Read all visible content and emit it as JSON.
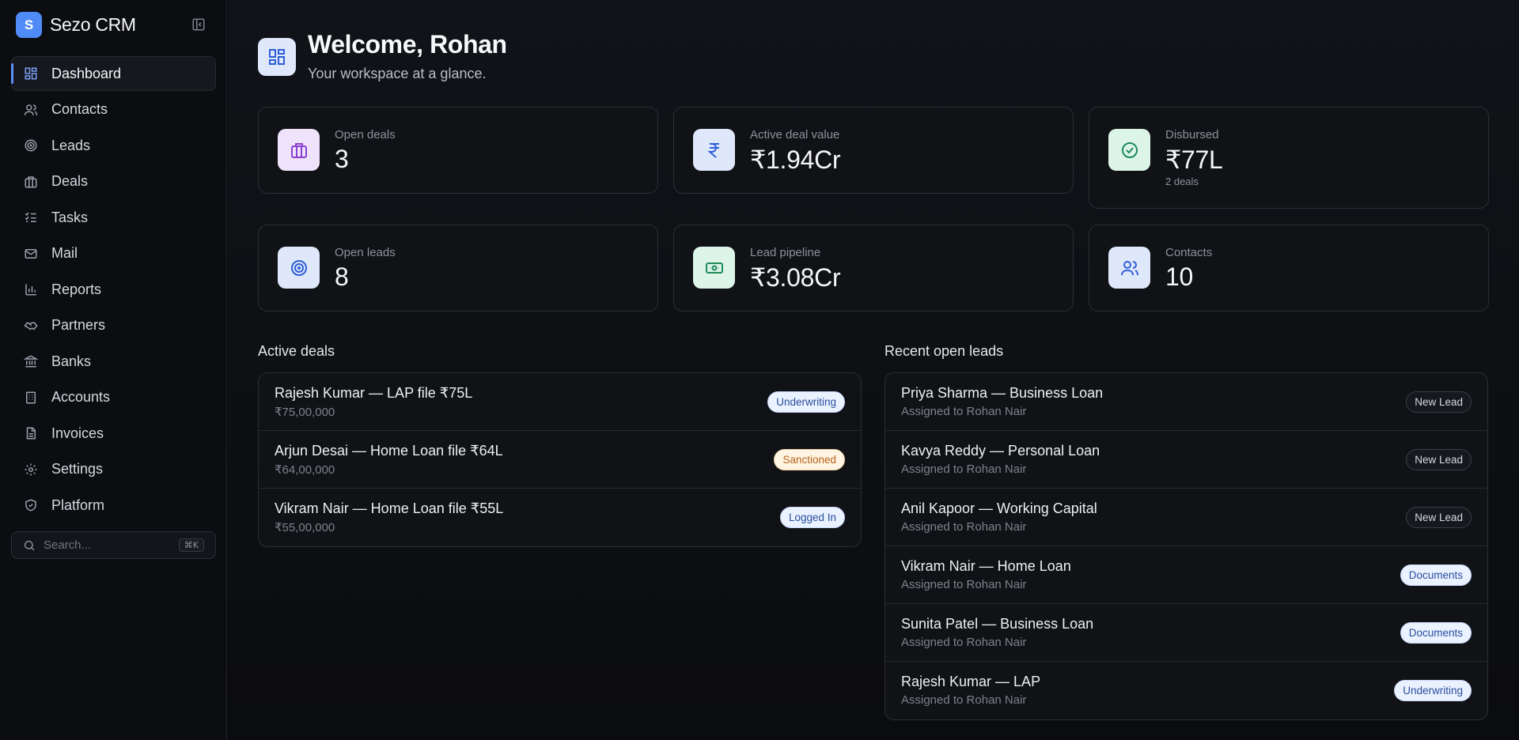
{
  "sidebar": {
    "brand_letter": "S",
    "brand_name": "Sezo CRM",
    "items": [
      {
        "label": "Dashboard",
        "icon": "dashboard-icon",
        "active": true
      },
      {
        "label": "Contacts",
        "icon": "users-icon"
      },
      {
        "label": "Leads",
        "icon": "target-icon"
      },
      {
        "label": "Deals",
        "icon": "briefcase-icon"
      },
      {
        "label": "Tasks",
        "icon": "checklist-icon"
      },
      {
        "label": "Mail",
        "icon": "mail-icon"
      },
      {
        "label": "Reports",
        "icon": "bar-chart-icon"
      },
      {
        "label": "Partners",
        "icon": "handshake-icon"
      },
      {
        "label": "Banks",
        "icon": "bank-icon"
      },
      {
        "label": "Accounts",
        "icon": "building-icon"
      },
      {
        "label": "Invoices",
        "icon": "file-icon"
      },
      {
        "label": "Settings",
        "icon": "gear-icon"
      },
      {
        "label": "Platform",
        "icon": "shield-icon"
      }
    ],
    "search_placeholder": "Search...",
    "search_shortcut": "⌘K"
  },
  "header": {
    "title": "Welcome, Rohan",
    "subtitle": "Your workspace at a glance."
  },
  "stats": [
    {
      "label": "Open deals",
      "value": "3",
      "icon": "briefcase-icon",
      "color": "#8b3fd0"
    },
    {
      "label": "Active deal value",
      "value": "₹1.94Cr",
      "icon": "rupee-icon",
      "color": "#2f5fd6"
    },
    {
      "label": "Disbursed",
      "value": "₹77L",
      "sub": "2 deals",
      "icon": "check-circle-icon",
      "color": "#1f8a5a"
    },
    {
      "label": "Open leads",
      "value": "8",
      "icon": "target-icon",
      "color": "#2f5fd6"
    },
    {
      "label": "Lead pipeline",
      "value": "₹3.08Cr",
      "icon": "banknote-icon",
      "color": "#1f8a5a"
    },
    {
      "label": "Contacts",
      "value": "10",
      "icon": "users-icon",
      "color": "#2f5fd6"
    }
  ],
  "active_deals": {
    "title": "Active deals",
    "rows": [
      {
        "title": "Rajesh Kumar — LAP file ₹75L",
        "sub": "₹75,00,000",
        "badge": "Underwriting",
        "badge_style": "blue"
      },
      {
        "title": "Arjun Desai — Home Loan file ₹64L",
        "sub": "₹64,00,000",
        "badge": "Sanctioned",
        "badge_style": "amber"
      },
      {
        "title": "Vikram Nair — Home Loan file ₹55L",
        "sub": "₹55,00,000",
        "badge": "Logged In",
        "badge_style": "blue"
      }
    ]
  },
  "recent_leads": {
    "title": "Recent open leads",
    "rows": [
      {
        "title": "Priya Sharma — Business Loan",
        "sub": "Assigned to Rohan Nair",
        "badge": "New Lead",
        "badge_style": "dark"
      },
      {
        "title": "Kavya Reddy — Personal Loan",
        "sub": "Assigned to Rohan Nair",
        "badge": "New Lead",
        "badge_style": "dark"
      },
      {
        "title": "Anil Kapoor — Working Capital",
        "sub": "Assigned to Rohan Nair",
        "badge": "New Lead",
        "badge_style": "dark"
      },
      {
        "title": "Vikram Nair — Home Loan",
        "sub": "Assigned to Rohan Nair",
        "badge": "Documents",
        "badge_style": "blue"
      },
      {
        "title": "Sunita Patel — Business Loan",
        "sub": "Assigned to Rohan Nair",
        "badge": "Documents",
        "badge_style": "blue"
      },
      {
        "title": "Rajesh Kumar — LAP",
        "sub": "Assigned to Rohan Nair",
        "badge": "Underwriting",
        "badge_style": "blue"
      }
    ]
  }
}
